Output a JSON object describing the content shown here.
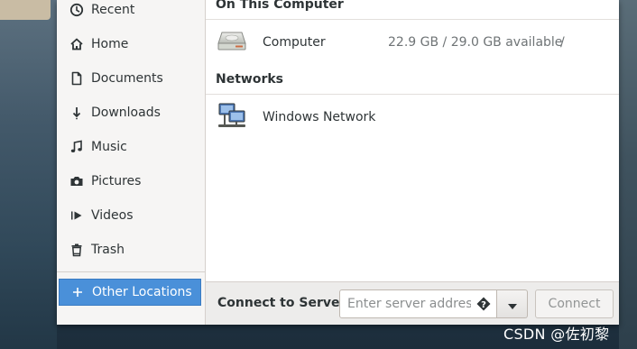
{
  "sidebar": {
    "items": [
      {
        "label": "Recent",
        "icon": "clock-icon"
      },
      {
        "label": "Home",
        "icon": "home-icon"
      },
      {
        "label": "Documents",
        "icon": "document-icon"
      },
      {
        "label": "Downloads",
        "icon": "download-arrow-icon"
      },
      {
        "label": "Music",
        "icon": "music-note-icon"
      },
      {
        "label": "Pictures",
        "icon": "camera-icon"
      },
      {
        "label": "Videos",
        "icon": "video-icon"
      },
      {
        "label": "Trash",
        "icon": "trash-icon"
      }
    ],
    "other_locations": {
      "label": "Other Locations",
      "icon": "plus-icon",
      "selected": true
    }
  },
  "main": {
    "on_this_computer": {
      "heading": "On This Computer",
      "rows": [
        {
          "name": "Computer",
          "size": "22.9 GB / 29.0 GB available",
          "path": "/",
          "icon": "hard-drive-icon"
        }
      ]
    },
    "networks": {
      "heading": "Networks",
      "rows": [
        {
          "name": "Windows Network",
          "icon": "network-computers-icon"
        }
      ]
    }
  },
  "bottom": {
    "connect_label": "Connect to Server",
    "server_input": {
      "value": "",
      "placeholder": "Enter server address…"
    },
    "connect_button": "Connect"
  },
  "watermark": "CSDN @佐初黎",
  "colors": {
    "accent": "#4a90d9",
    "sidebar_bg": "#f6f5f4"
  }
}
